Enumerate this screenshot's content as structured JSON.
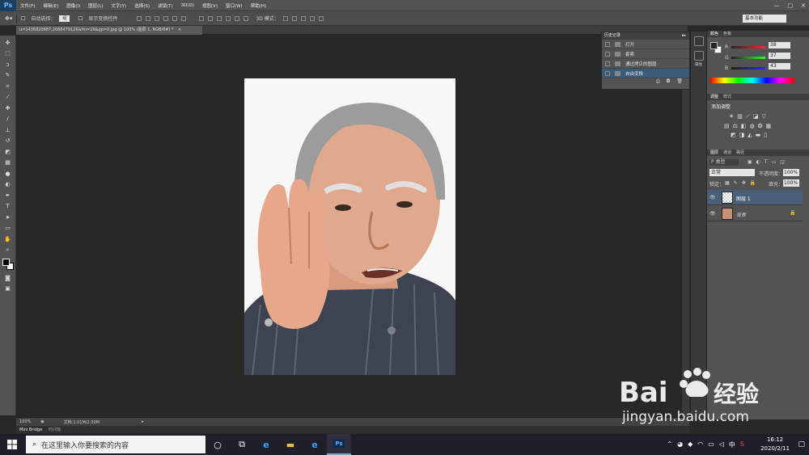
{
  "menu": {
    "logo": "Ps",
    "items": [
      "文件(F)",
      "编辑(E)",
      "图像(I)",
      "图层(L)",
      "文字(Y)",
      "选择(S)",
      "滤镜(T)",
      "3D(D)",
      "视图(V)",
      "窗口(W)",
      "帮助(H)"
    ]
  },
  "options": {
    "auto_select_label": "自动选择：",
    "auto_select_value": "组",
    "show_transform_label": "显示变换控件",
    "mode_3d_label": "3D 模式：",
    "workspace": "基本功能"
  },
  "document": {
    "tab_title": "u=1436820887,2068479126&fm=26&gp=0.jpg @ 100% (图层 1, RGB/8#) *",
    "zoom": "100%",
    "doc_info": "文档:1.01M/2.00M"
  },
  "bottom_tabs": [
    "Mini Bridge",
    "时间轴"
  ],
  "history": {
    "title": "历史记录",
    "items": [
      {
        "label": "打开",
        "active": false
      },
      {
        "label": "套索",
        "active": false
      },
      {
        "label": "通过拷贝的图层",
        "active": false
      },
      {
        "label": "自由变换",
        "active": true
      }
    ]
  },
  "dock": {
    "brush_label": "",
    "props_label": "属性"
  },
  "color_panel": {
    "tabs": [
      "颜色",
      "色板"
    ],
    "r_label": "R",
    "r_value": "38",
    "g_label": "G",
    "g_value": "37",
    "b_label": "B",
    "b_value": "43"
  },
  "adjust_panel": {
    "tabs": [
      "调整",
      "样式"
    ],
    "add_label": "添加调整"
  },
  "layers_panel": {
    "tabs": [
      "图层",
      "通道",
      "路径"
    ],
    "filter_label": "P 类型",
    "blend_mode": "正常",
    "opacity_label": "不透明度：",
    "opacity_value": "100%",
    "lock_label": "锁定：",
    "fill_label": "填充：",
    "fill_value": "100%",
    "layers": [
      {
        "name": "图层 1",
        "selected": true
      },
      {
        "name": "背景",
        "selected": false
      }
    ]
  },
  "taskbar": {
    "search_placeholder": "在这里输入你要搜索的内容",
    "time": "16:12",
    "date": "2020/2/11"
  },
  "watermark": {
    "brand": "Bai",
    "brand2": "经验",
    "url": "jingyan.baidu.com"
  }
}
